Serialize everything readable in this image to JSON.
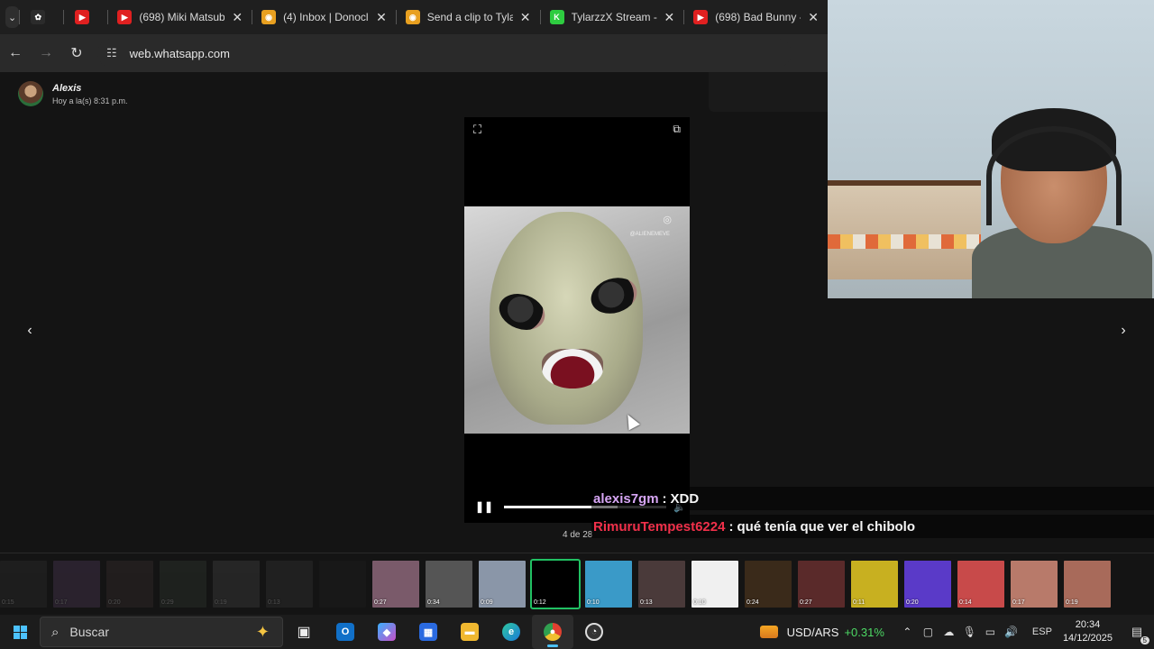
{
  "browser": {
    "tabs": [
      {
        "title": "",
        "favicon": "chatgpt-icon",
        "color": "#2b2b2b"
      },
      {
        "title": "",
        "favicon": "youtube-icon",
        "color": "#e02020"
      },
      {
        "title": "(698) Miki Matsub",
        "favicon": "youtube-icon",
        "color": "#e02020"
      },
      {
        "title": "(4) Inbox | Donocl",
        "favicon": "donation-icon",
        "color": "#e8a020"
      },
      {
        "title": "Send a clip to Tyla",
        "favicon": "donation-icon",
        "color": "#e8a020"
      },
      {
        "title": "TylarzzX Stream -",
        "favicon": "kick-icon",
        "color": "#2ecc40"
      },
      {
        "title": "(698) Bad Bunny -",
        "favicon": "youtube-icon",
        "color": "#e02020"
      }
    ],
    "url": "web.whatsapp.com"
  },
  "viewer": {
    "sender_name": "Alexis",
    "sender_time": "Hoy a la(s) 8:31 p.m.",
    "watermark_handle": "@ALIENEMEVE",
    "progress": 0.7,
    "counter": "4 de 28"
  },
  "thumbnails": [
    {
      "dur": "0:15",
      "bg": "#3a3a3a",
      "dim": true
    },
    {
      "dur": "0:17",
      "bg": "#6b4c7a",
      "dim": true
    },
    {
      "dur": "0:20",
      "bg": "#4a3a3a",
      "dim": true
    },
    {
      "dur": "0:29",
      "bg": "#3e4a3e",
      "dim": true
    },
    {
      "dur": "0:19",
      "bg": "#5a5a5a",
      "dim": true
    },
    {
      "dur": "0:13",
      "bg": "#444",
      "dim": true
    },
    {
      "dur": "",
      "bg": "#222",
      "dim": true
    },
    {
      "dur": "0:27",
      "bg": "#7a5a6a",
      "dim": false
    },
    {
      "dur": "0:34",
      "bg": "#555",
      "dim": false
    },
    {
      "dur": "0:09",
      "bg": "#8a96a8",
      "dim": false
    },
    {
      "dur": "0:12",
      "bg": "#000",
      "dim": false,
      "selected": true
    },
    {
      "dur": "0:10",
      "bg": "#3a9ac8",
      "dim": false
    },
    {
      "dur": "0:13",
      "bg": "#4a3a3a",
      "dim": false
    },
    {
      "dur": "0:10",
      "bg": "#f0f0f0",
      "dim": false
    },
    {
      "dur": "0:24",
      "bg": "#3a2a1a",
      "dim": false
    },
    {
      "dur": "0:27",
      "bg": "#5a2a2a",
      "dim": false
    },
    {
      "dur": "0:11",
      "bg": "#c8b020",
      "dim": false
    },
    {
      "dur": "0:20",
      "bg": "#5a3ac8",
      "dim": false
    },
    {
      "dur": "0:14",
      "bg": "#c84a4a",
      "dim": false
    },
    {
      "dur": "0:17",
      "bg": "#b87a6a",
      "dim": false
    },
    {
      "dur": "0:19",
      "bg": "#a86a5a",
      "dim": false
    }
  ],
  "chat": [
    {
      "user": "alexis7gm",
      "user_color": "#d7a6f5",
      "sep": ":",
      "message": "XDD"
    },
    {
      "user": "RimuruTempest6224",
      "user_color": "#f0304a",
      "sep": ":",
      "message": "qué tenía que ver el chibolo"
    }
  ],
  "taskbar": {
    "search_placeholder": "Buscar",
    "ticker_name": "USD/ARS",
    "ticker_change": "+0.31%",
    "lang": "ESP",
    "time": "20:34",
    "date": "14/12/2025",
    "notif_count": "5"
  }
}
